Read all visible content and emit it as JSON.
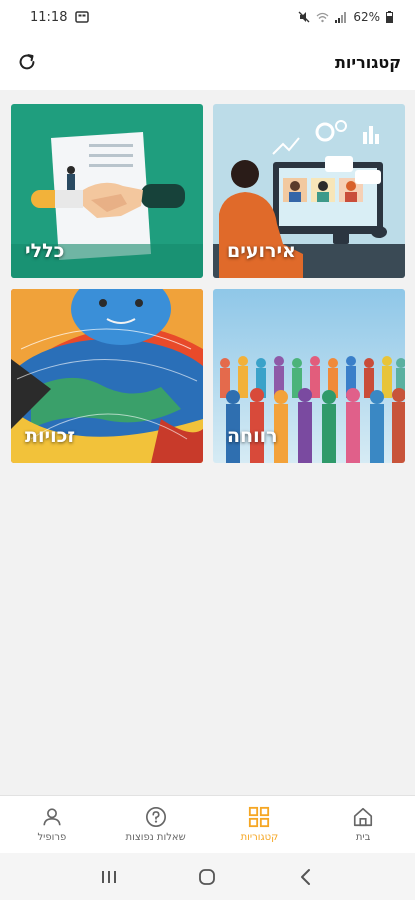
{
  "status_bar": {
    "time": "11:18",
    "battery": "62%"
  },
  "header": {
    "title": "קטגוריות"
  },
  "categories": [
    {
      "label": "אירועים"
    },
    {
      "label": "כללי"
    },
    {
      "label": "רווחה"
    },
    {
      "label": "זכויות"
    }
  ],
  "bottom_nav": {
    "items": [
      {
        "label": "בית"
      },
      {
        "label": "קטגוריות"
      },
      {
        "label": "שאלות נפוצות"
      },
      {
        "label": "פרופיל"
      }
    ],
    "active_index": 1,
    "active_color": "#f5a623"
  }
}
